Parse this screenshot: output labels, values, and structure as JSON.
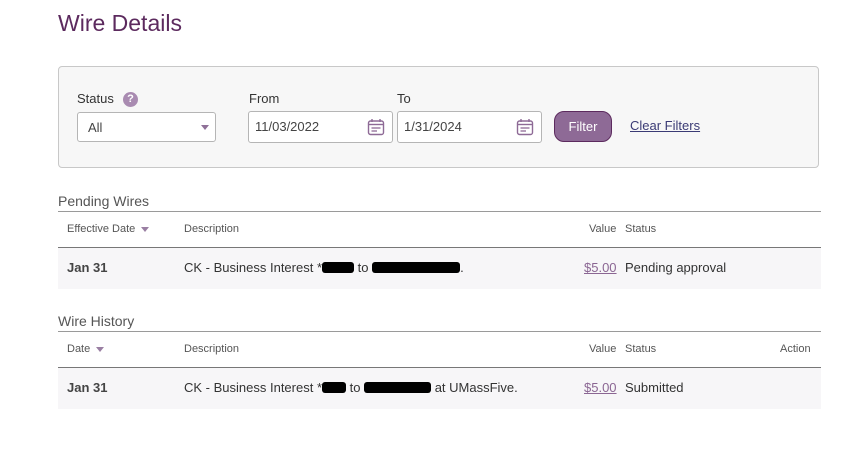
{
  "page": {
    "title": "Wire Details"
  },
  "filters": {
    "status_label": "Status",
    "help_glyph": "?",
    "status_value": "All",
    "from_label": "From",
    "from_value": "11/03/2022",
    "to_label": "To",
    "to_value": "1/31/2024",
    "filter_button": "Filter",
    "clear_link": "Clear Filters"
  },
  "pending": {
    "title": "Pending Wires",
    "headers": {
      "date": "Effective Date",
      "description": "Description",
      "value": "Value",
      "status": "Status"
    },
    "rows": [
      {
        "date": "Jan 31",
        "desc_prefix": "CK - Business Interest *",
        "desc_mid": " to ",
        "desc_suffix": ".",
        "value": "$5.00",
        "status": "Pending approval"
      }
    ]
  },
  "history": {
    "title": "Wire History",
    "headers": {
      "date": "Date",
      "description": "Description",
      "value": "Value",
      "status": "Status",
      "action": "Action"
    },
    "rows": [
      {
        "date": "Jan 31",
        "desc_prefix": "CK - Business Interest *",
        "desc_mid": " to ",
        "desc_suffix": " at UMassFive.",
        "value": "$5.00",
        "status": "Submitted"
      }
    ]
  },
  "colors": {
    "accent": "#5c2a5e",
    "button": "#8e6a96",
    "link": "#8b6693"
  },
  "icons": {
    "help": "question-circle",
    "calendar": "calendar",
    "sort": "chevron-down",
    "dropdown": "caret-down"
  }
}
